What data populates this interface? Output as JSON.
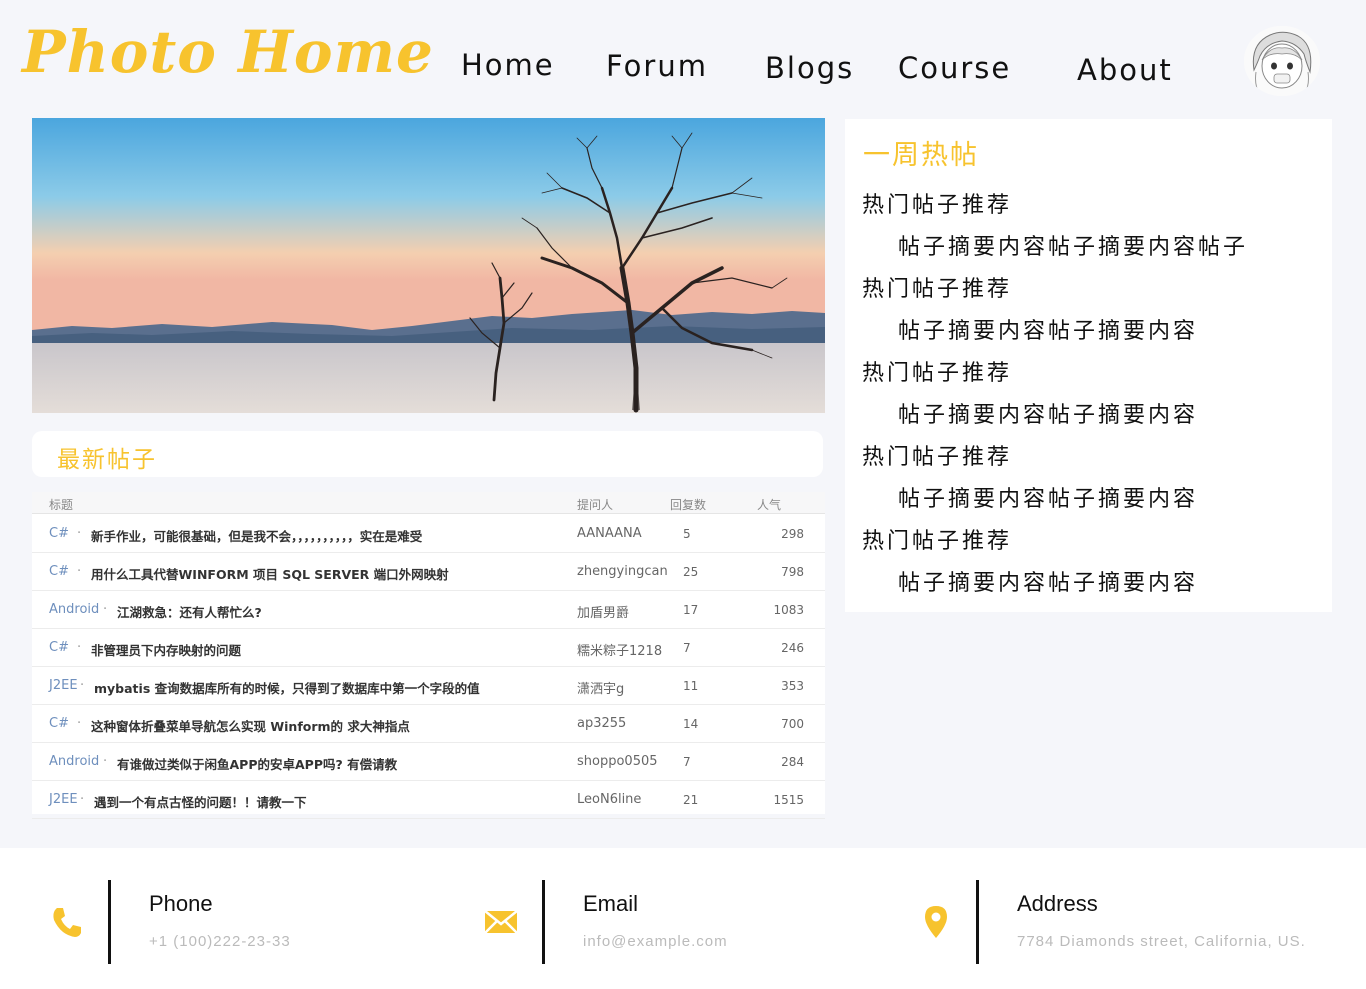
{
  "header": {
    "logo": "Photo Home",
    "nav": [
      "Home",
      "Forum",
      "Blogs",
      "Course",
      "About"
    ]
  },
  "latest": {
    "title": "最新帖子",
    "columns": {
      "title": "标题",
      "author": "提问人",
      "replies": "回复数",
      "popularity": "人气"
    },
    "rows": [
      {
        "category": "C#",
        "title": "新手作业，可能很基础，但是我不会，，，，，，，，，，实在是难受",
        "author": "AANAANA",
        "replies": "5",
        "popularity": "298"
      },
      {
        "category": "C#",
        "title": "用什么工具代替WINFORM 项目 SQL SERVER 端口外网映射",
        "author": "zhengyingcan",
        "replies": "25",
        "popularity": "798"
      },
      {
        "category": "Android",
        "title": "江湖救急：还有人帮忙么?",
        "author": "加盾男爵",
        "replies": "17",
        "popularity": "1083"
      },
      {
        "category": "C#",
        "title": "非管理员下内存映射的问题",
        "author": "糯米粽子1218",
        "replies": "7",
        "popularity": "246"
      },
      {
        "category": "J2EE",
        "title": "mybatis 查询数据库所有的时候，只得到了数据库中第一个字段的值",
        "author": "潇洒宇g",
        "replies": "11",
        "popularity": "353"
      },
      {
        "category": "C#",
        "title": "这种窗体折叠菜单导航怎么实现 Winform的 求大神指点",
        "author": "ap3255",
        "replies": "14",
        "popularity": "700"
      },
      {
        "category": "Android",
        "title": "有谁做过类似于闲鱼APP的安卓APP吗? 有偿请教",
        "author": "shoppo0505",
        "replies": "7",
        "popularity": "284"
      },
      {
        "category": "J2EE",
        "title": "遇到一个有点古怪的问题！！请教一下",
        "author": "LeoN6line",
        "replies": "21",
        "popularity": "1515"
      }
    ]
  },
  "hot": {
    "title": "一周热帖",
    "items": [
      {
        "heading": "热门帖子推荐",
        "summary": "帖子摘要内容帖子摘要内容帖子"
      },
      {
        "heading": "热门帖子推荐",
        "summary": "帖子摘要内容帖子摘要内容"
      },
      {
        "heading": "热门帖子推荐",
        "summary": "帖子摘要内容帖子摘要内容"
      },
      {
        "heading": "热门帖子推荐",
        "summary": "帖子摘要内容帖子摘要内容"
      },
      {
        "heading": "热门帖子推荐",
        "summary": "帖子摘要内容帖子摘要内容"
      }
    ]
  },
  "footer": {
    "phone": {
      "label": "Phone",
      "value": "+1 (100)222-23-33",
      "icon": "phone-icon"
    },
    "email": {
      "label": "Email",
      "value": "info@example.com",
      "icon": "mail-icon"
    },
    "address": {
      "label": "Address",
      "value": "7784 Diamonds street, California, US.",
      "icon": "location-pin-icon"
    }
  },
  "colors": {
    "accent": "#f7c32e",
    "category_link": "#6e8fbd",
    "background": "#f5f6fa"
  }
}
